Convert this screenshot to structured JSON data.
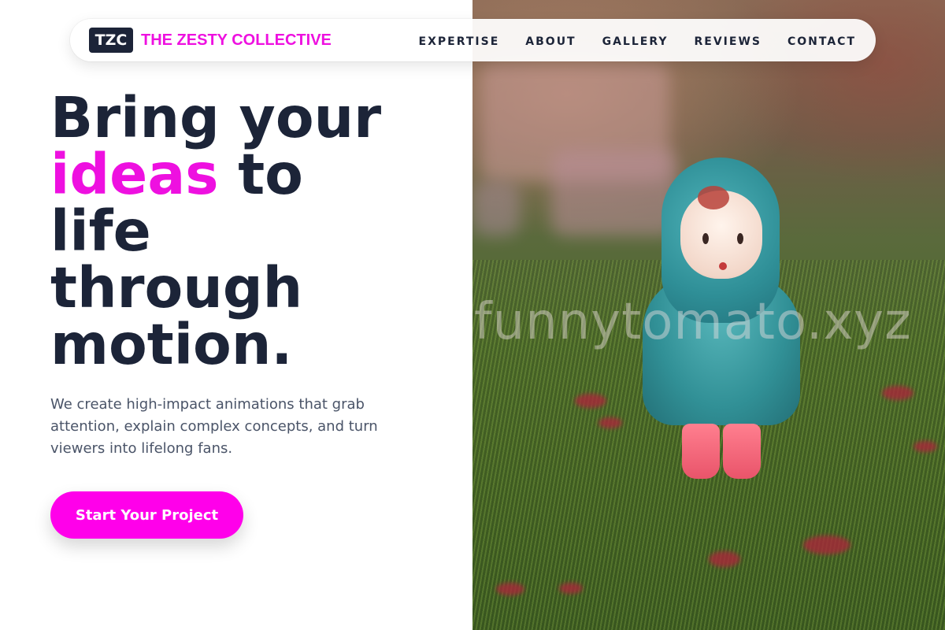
{
  "brand": {
    "badge": "TZC",
    "name": "THE ZESTY COLLECTIVE",
    "accent_color": "#ee10e0",
    "badge_color": "#1c2438"
  },
  "nav": {
    "items": [
      {
        "label": "EXPERTISE"
      },
      {
        "label": "ABOUT"
      },
      {
        "label": "GALLERY"
      },
      {
        "label": "REVIEWS"
      },
      {
        "label": "CONTACT"
      }
    ]
  },
  "hero": {
    "title_lines": [
      "Bring your",
      "ideas",
      "to",
      "life",
      "through",
      "motion."
    ],
    "description": "We create high-impact animations that grab attention, explain complex concepts, and turn viewers into lifelong fans.",
    "cta_label": "Start Your Project",
    "cta_color": "#ff00ea",
    "text_color": "#1c2438"
  },
  "image": {
    "subject": "figurine-in-blue-raincoat-on-grass",
    "watermark": "funnytomato.xyz"
  }
}
